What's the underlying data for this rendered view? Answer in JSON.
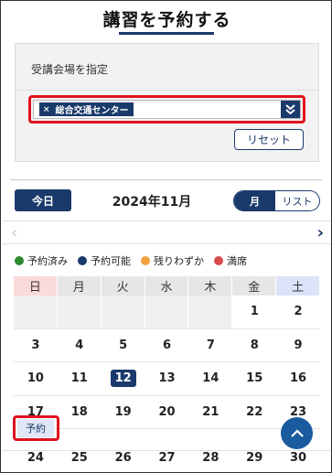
{
  "page": {
    "title": "講習を予約する"
  },
  "venue": {
    "label": "受講会場を指定",
    "selected_chip": "総合交通センター",
    "chip_remove": "×",
    "dropdown_icon": "double-chevron-down-icon",
    "reset_label": "リセット"
  },
  "calendar": {
    "today_label": "今日",
    "month_label": "2024年11月",
    "view_month": "月",
    "view_list": "リスト",
    "prev_arrow": "‹",
    "next_arrow": "›",
    "legend": [
      {
        "label": "予約済み",
        "color": "#2e8b2e"
      },
      {
        "label": "予約可能",
        "color": "#1a3a6b"
      },
      {
        "label": "残りわずか",
        "color": "#f0a040"
      },
      {
        "label": "満席",
        "color": "#d94a4a"
      }
    ],
    "weekdays": [
      "日",
      "月",
      "火",
      "水",
      "木",
      "金",
      "土"
    ],
    "weeks": [
      [
        "",
        "",
        "",
        "",
        "",
        "1",
        "2"
      ],
      [
        "3",
        "4",
        "5",
        "6",
        "7",
        "8",
        "9"
      ],
      [
        "10",
        "11",
        "12",
        "13",
        "14",
        "15",
        "16"
      ],
      [
        "17",
        "18",
        "19",
        "20",
        "21",
        "22",
        "23"
      ]
    ],
    "partial_week": [
      "24",
      "25",
      "26",
      "27",
      "28",
      "29",
      "30"
    ],
    "today_date": "12",
    "reserve_tag": "予約"
  },
  "colors": {
    "primary": "#1a3a6b",
    "highlight_outline": "#e0121d"
  }
}
